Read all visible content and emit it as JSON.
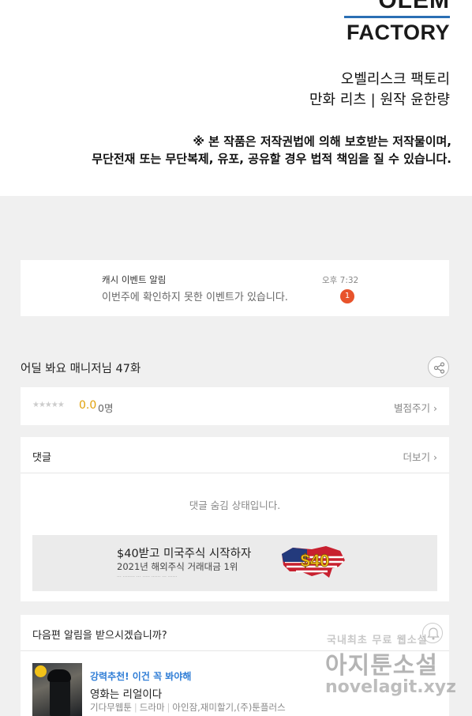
{
  "comic_footer": {
    "logo_line1": "OLEM",
    "logo_line2": "FACTORY",
    "credit_line1": "오벨리스크 팩토리",
    "credit_line2": "만화 리츠 | 원작 윤한량",
    "notice_line1": "※ 본 작품은 저작권법에 의해 보호받는 저작물이며,",
    "notice_line2": "무단전재 또는 무단복제, 유포, 공유할 경우 법적 책임을 질 수 있습니다."
  },
  "notification": {
    "title": "캐시 이벤트 알림",
    "message": "이번주에 확인하지 못한 이벤트가 있습니다.",
    "time": "오후 7:32",
    "badge_count": "1"
  },
  "episode": {
    "title": "어딜 봐요 매니저님 47화"
  },
  "rating": {
    "stars": "★★★★★",
    "score": "0.0",
    "count": "0명",
    "rate_link": "별점주기 ›"
  },
  "comments": {
    "header": "댓글",
    "more": "더보기 ›",
    "empty_text": "댓글 숨김 상태입니다."
  },
  "ad": {
    "title": "$40받고 미국주식 시작하자",
    "subtitle": "2021년 해외주식 거래대금 1위",
    "badge": "$40"
  },
  "next_alert": {
    "question": "다음편 알림을 받으시겠습니까?"
  },
  "recommendation": {
    "tag": "강력추천! 이건 꼭 봐야해",
    "title": "영화는 리얼이다",
    "meta": [
      "기다무웹툰",
      "드라마",
      "아인잠,재미할기,(주)툰플러스"
    ]
  },
  "watermark": {
    "line1": "국내최초 무료 웹소설",
    "line2": "아지툰소설",
    "line3": "novelagit.xyz"
  },
  "colors": {
    "accent_blue": "#2f7dd6",
    "score_gold": "#e0a10a",
    "badge_red": "#e8532b",
    "logo_blue": "#2b6fb4"
  }
}
